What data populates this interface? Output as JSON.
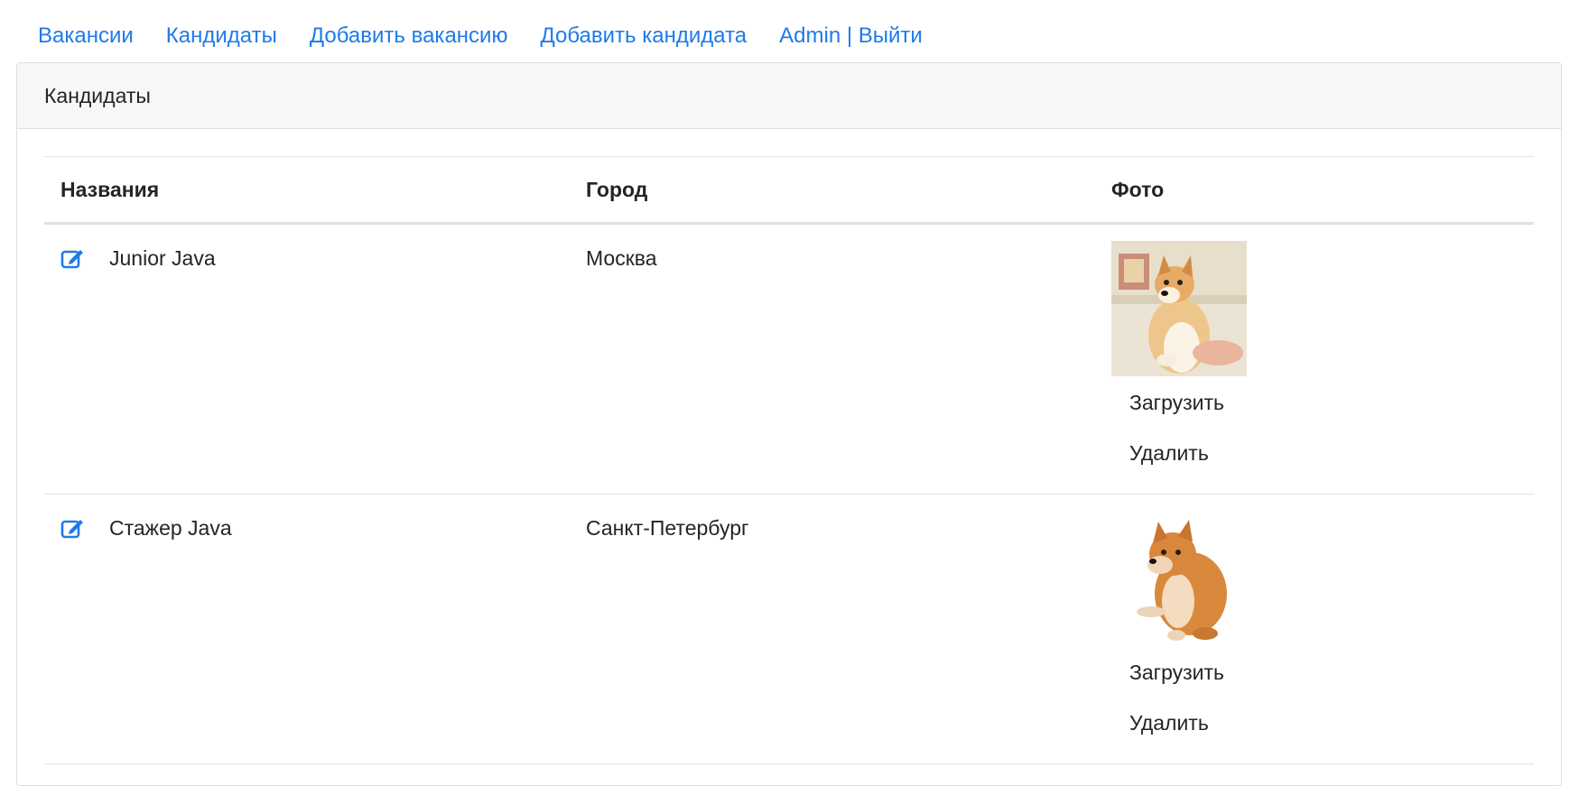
{
  "nav": {
    "items": [
      {
        "label": "Вакансии"
      },
      {
        "label": "Кандидаты"
      },
      {
        "label": "Добавить вакансию"
      },
      {
        "label": "Добавить кандидата"
      },
      {
        "label": "Admin | Выйти"
      }
    ]
  },
  "card": {
    "title": "Кандидаты"
  },
  "table": {
    "headers": [
      "Названия",
      "Город",
      "Фото"
    ],
    "rows": [
      {
        "name": "Junior Java",
        "city": "Москва",
        "upload_label": "Загрузить",
        "delete_label": "Удалить",
        "photo_icon": "shiba-photo"
      },
      {
        "name": "Стажер Java",
        "city": "Санкт-Петербург",
        "upload_label": "Загрузить",
        "delete_label": "Удалить",
        "photo_icon": "cheems-photo"
      }
    ]
  },
  "colors": {
    "link": "#1f7ae8",
    "text": "#212529",
    "header_bg": "#f7f7f7"
  }
}
